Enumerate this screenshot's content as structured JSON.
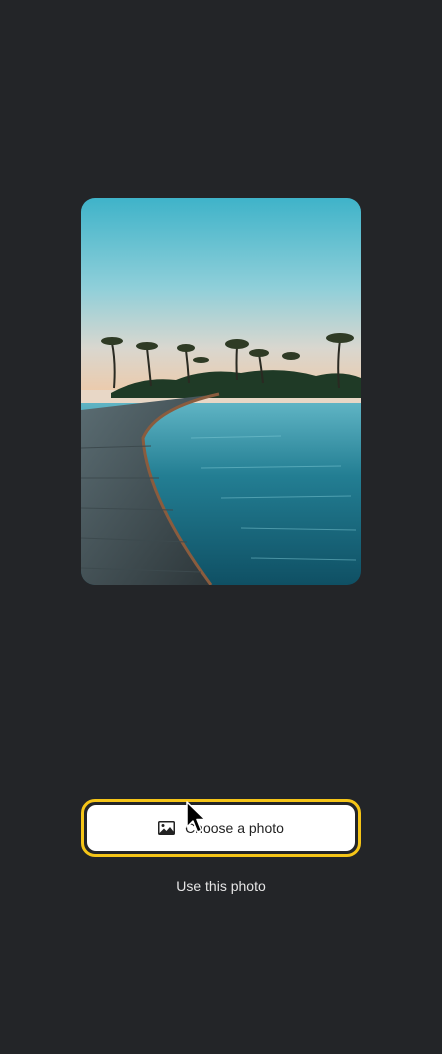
{
  "photo": {
    "subject": "palm trees, wooden boardwalk over turquoise water"
  },
  "buttons": {
    "choose_label": "Choose a photo",
    "choose_icon": "image-icon",
    "use_label": "Use this photo"
  },
  "colors": {
    "background": "#232528",
    "focus_ring": "#f5c518",
    "button_bg": "#ffffff"
  }
}
